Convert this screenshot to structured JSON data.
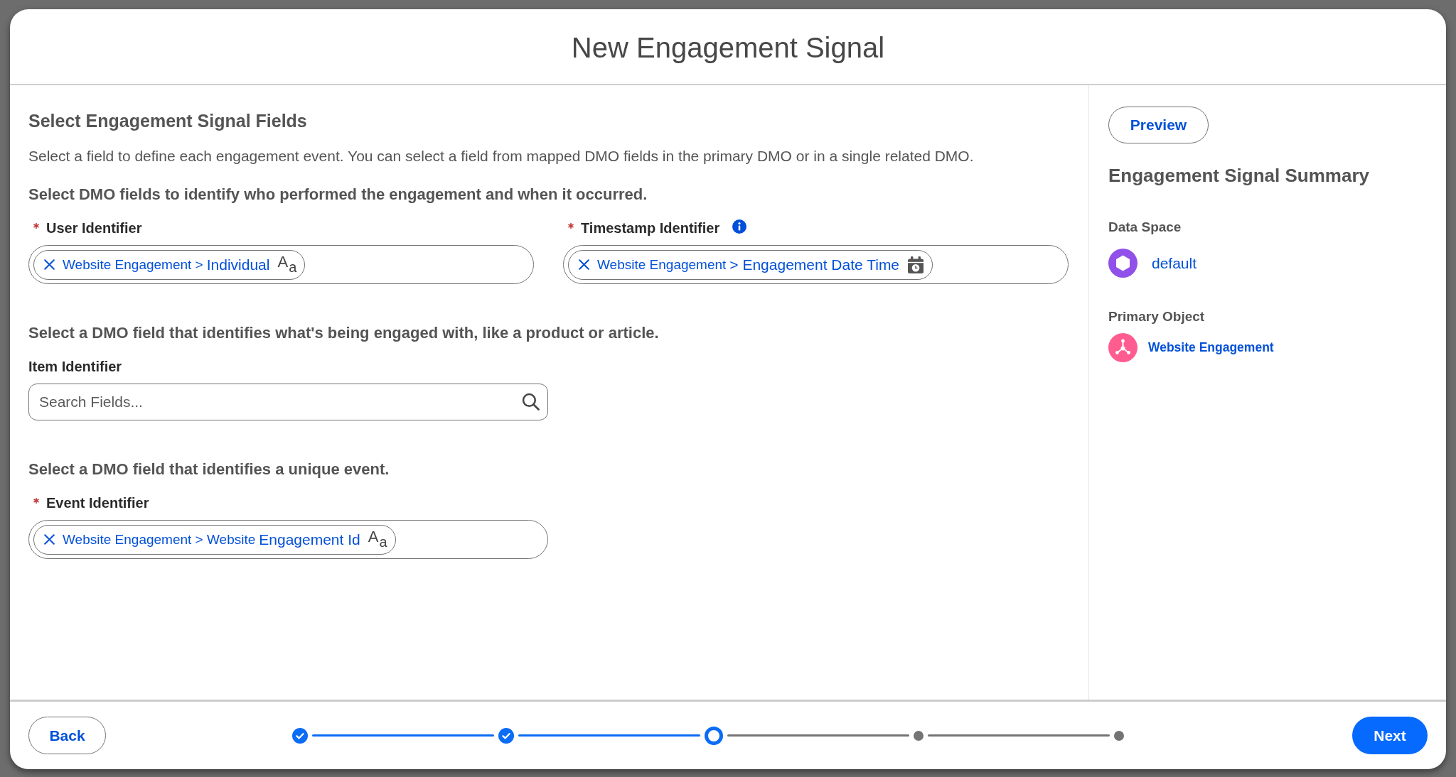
{
  "modal": {
    "title": "New Engagement Signal"
  },
  "form": {
    "heading": "Select Engagement Signal Fields",
    "description": "Select a field to define each engagement event. You can select a field from mapped DMO fields in the primary DMO or in a single related DMO.",
    "sections": [
      {
        "heading": "Select DMO fields to identify who performed the engagement and when it occurred.",
        "fields": [
          {
            "label": "User Identifier",
            "required": true,
            "info": false,
            "kind": "selection",
            "selection": {
              "path": "Website Engagement >",
              "name": "Individual",
              "kind": "text",
              "type_glyph": "A$_{a}$"
            }
          },
          {
            "label": "Timestamp Identifier",
            "required": true,
            "info": true,
            "kind": "selection",
            "selection": {
              "path": "Website Engagement",
              "name": "> Engagement Date Time",
              "kind": "datetime"
            }
          }
        ]
      },
      {
        "heading": "Select a DMO field that identifies what's being engaged with, like a product or article.",
        "fields": [
          {
            "label": "Item Identifier",
            "required": false,
            "info": false,
            "kind": "search",
            "placeholder": "Search Fields..."
          }
        ]
      },
      {
        "heading": "Select a DMO field that identifies a unique event.",
        "fields": [
          {
            "label": "Event Identifier",
            "required": true,
            "info": false,
            "kind": "selection",
            "selection": {
              "path": "Website Engagement > Website",
              "name": "Engagement Id",
              "kind": "text",
              "type_glyph": "A$_{a}$"
            }
          }
        ]
      }
    ]
  },
  "summary": {
    "preview": "Preview",
    "title": "Engagement Signal Summary",
    "items": [
      {
        "label": "Data Space",
        "kind": "data-space",
        "value": "default"
      },
      {
        "label": "Primary Object",
        "kind": "object",
        "value": "Website Engagement"
      }
    ]
  },
  "footer": {
    "back": "Back",
    "next": "Next",
    "steps": [
      {
        "completed": true,
        "current": false
      },
      {
        "completed": true,
        "current": false
      },
      {
        "completed": false,
        "current": true
      },
      {
        "completed": false,
        "current": false
      },
      {
        "completed": false,
        "current": false
      }
    ]
  }
}
